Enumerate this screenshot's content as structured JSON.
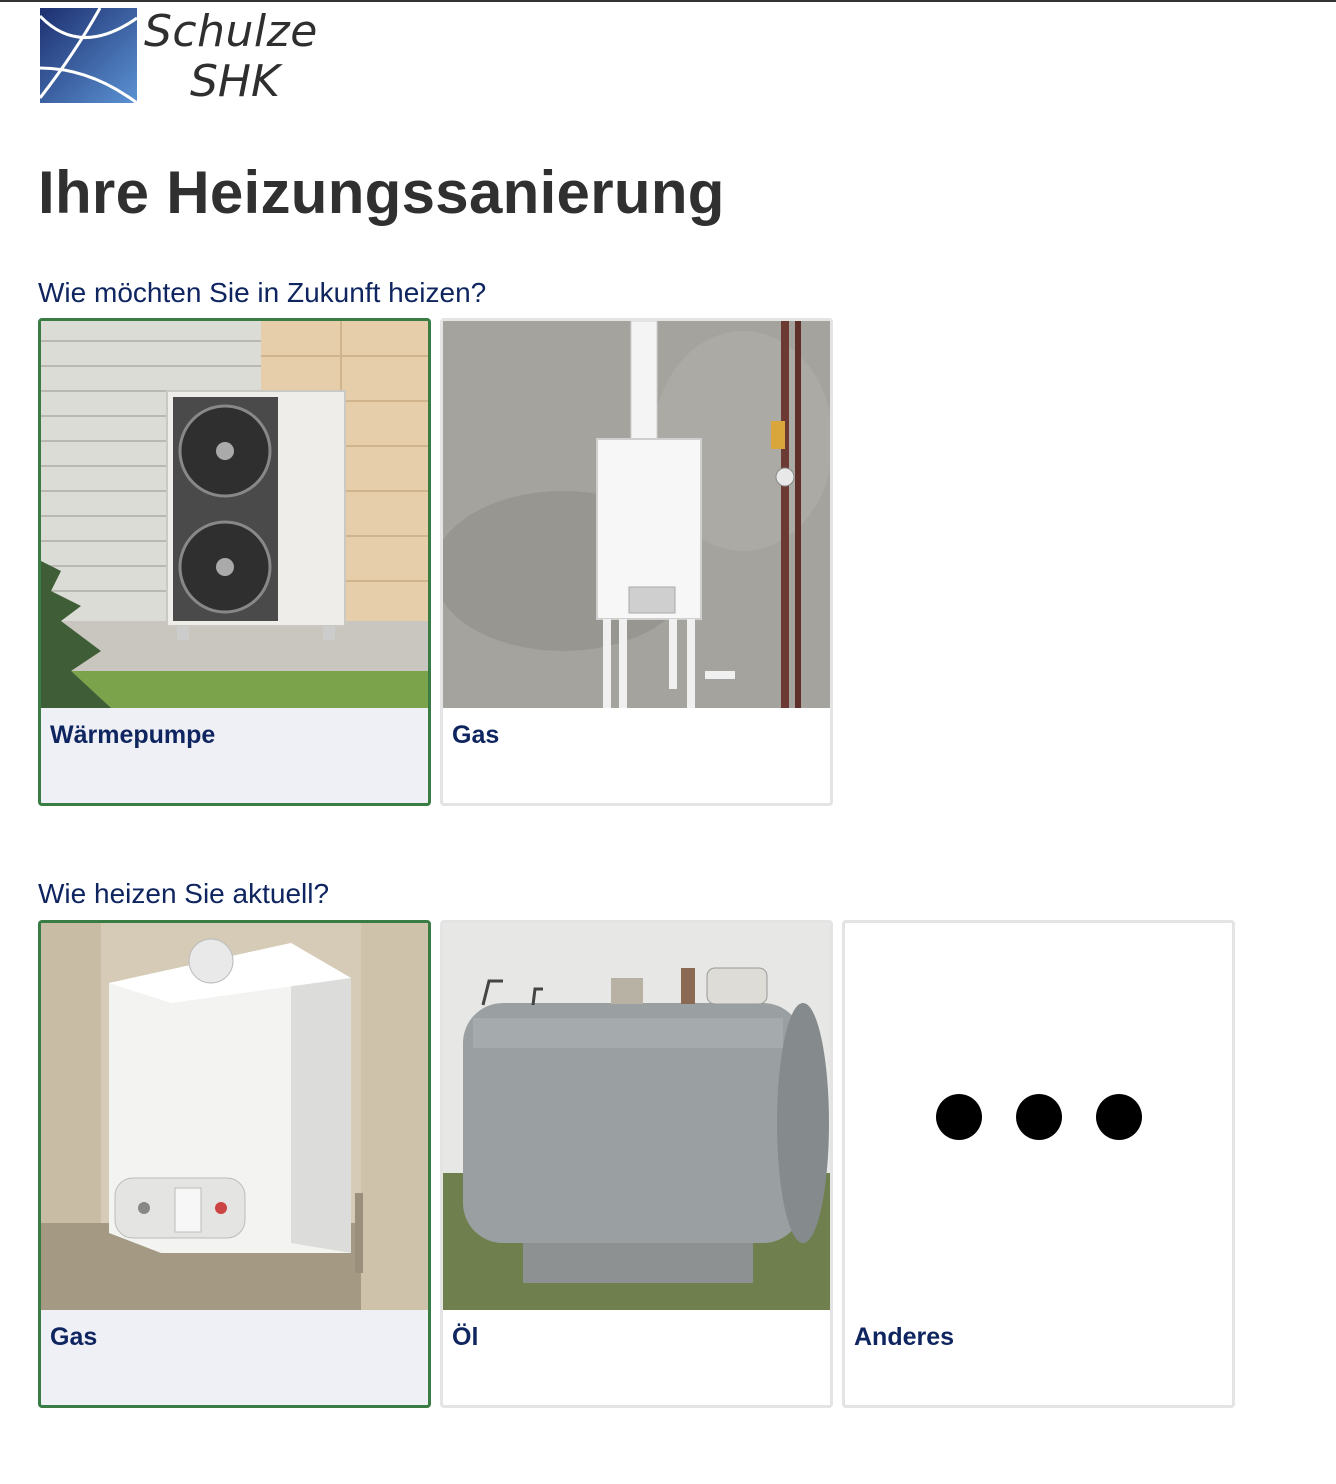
{
  "brand": {
    "line1": "Schulze",
    "line2": "SHK"
  },
  "page_title": "Ihre Heizungssanierung",
  "future_question": {
    "label": "Wie möchten Sie in Zukunft heizen?",
    "options": [
      {
        "label": "Wärmepumpe",
        "selected": true
      },
      {
        "label": "Gas",
        "selected": false
      }
    ]
  },
  "current_question": {
    "label": "Wie heizen Sie aktuell?",
    "options": [
      {
        "label": "Gas",
        "selected": true
      },
      {
        "label": "Öl",
        "selected": false
      },
      {
        "label": "Anderes",
        "selected": false
      }
    ]
  },
  "colors": {
    "accent_selected": "#3a7d44",
    "text_primary": "#0f2560",
    "heading": "#303030"
  }
}
